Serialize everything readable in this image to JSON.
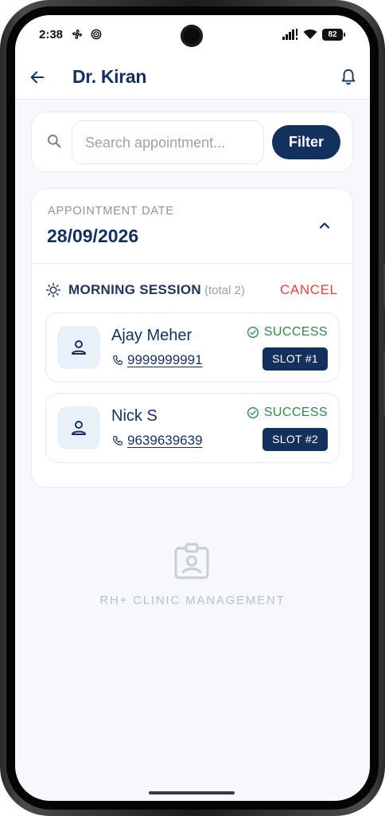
{
  "status_bar": {
    "time": "2:38",
    "battery": "82",
    "icons": [
      "fan-icon",
      "target-icon",
      "signal-icon",
      "wifi-icon",
      "battery-icon"
    ]
  },
  "app_bar": {
    "title": "Dr. Kiran",
    "back_icon": "arrow-left-icon",
    "notification_icon": "bell-icon"
  },
  "search": {
    "placeholder": "Search appointment...",
    "filter_label": "Filter"
  },
  "appointment": {
    "date_label": "APPOINTMENT DATE",
    "date_value": "28/09/2026",
    "session": {
      "title": "MORNING SESSION",
      "total": "(total 2)",
      "cancel_label": "CANCEL"
    },
    "patients": [
      {
        "name": "Ajay Meher",
        "phone": "9999999991",
        "status": "SUCCESS",
        "slot": "SLOT #1"
      },
      {
        "name": "Nick S",
        "phone": "9639639639",
        "status": "SUCCESS",
        "slot": "SLOT #2"
      }
    ]
  },
  "footer": {
    "text": "RH+ CLINIC MANAGEMENT"
  },
  "colors": {
    "primary": "#14315e",
    "success": "#2f8a4b",
    "danger": "#e0443a",
    "background": "#f6f8fb"
  }
}
